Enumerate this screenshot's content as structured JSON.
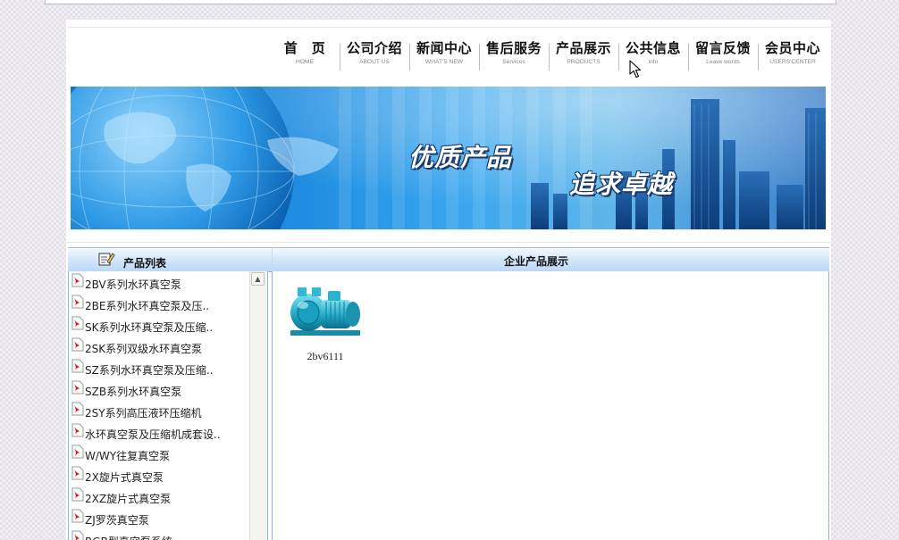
{
  "nav": [
    {
      "cn": "首　页",
      "en": "HOME"
    },
    {
      "cn": "公司介绍",
      "en": "ABOUT US"
    },
    {
      "cn": "新闻中心",
      "en": "WHAT'S NEW"
    },
    {
      "cn": "售后服务",
      "en": "Services"
    },
    {
      "cn": "产品展示",
      "en": "PRODUCTS"
    },
    {
      "cn": "公共信息",
      "en": "info"
    },
    {
      "cn": "留言反馈",
      "en": "Leave words"
    },
    {
      "cn": "会员中心",
      "en": "USERS'CENTER"
    }
  ],
  "banner": {
    "slogan1": "优质产品",
    "slogan2": "追求卓越"
  },
  "sidebar": {
    "title": "产品列表",
    "items": [
      "2BV系列水环真空泵",
      "2BE系列水环真空泵及压..",
      "SK系列水环真空泵及压缩..",
      "2SK系列双级水环真空泵",
      "SZ系列水环真空泵及压缩..",
      "SZB系列水环真空泵",
      "2SY系列高压液环压缩机",
      "水环真空泵及压缩机成套设..",
      "W/WY往复真空泵",
      "2X旋片式真空泵",
      "2XZ旋片式真空泵",
      "ZJ罗茨真空泵",
      "RGB型真空泵系统"
    ]
  },
  "main": {
    "title": "企业产品展示",
    "products": [
      {
        "name": "2bv6111"
      }
    ]
  },
  "colors": {
    "accent": "#0a78c8",
    "bar": "#d6e8fb",
    "border": "#8db3df"
  }
}
